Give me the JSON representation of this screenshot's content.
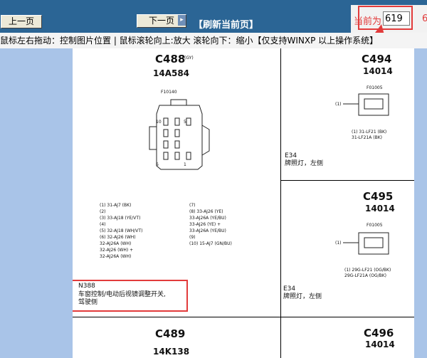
{
  "toolbar": {
    "prev_label": "上一页",
    "next_label": "下一页",
    "refresh_label": "【刷新当前页】",
    "current_label": "当前为",
    "current_page": "619",
    "next_arrow": "▸",
    "extra": "6"
  },
  "hint": {
    "text": "鼠标左右拖动：控制图片位置 | 鼠标滚轮向上:放大   滚轮向下：缩小【仅支持WINXP 以上操作系统】"
  },
  "colors": {
    "toolbar_bg": "#2b6595",
    "sidebar_bg": "#a9c4e8",
    "highlight": "#e23b3b"
  },
  "connectors": {
    "c488": {
      "code": "C488",
      "color_code": "(GY)",
      "part_number": "14A584",
      "figure_ref": "F10140",
      "pin_top_left": "10",
      "pin_top_right": "5",
      "pin_bottom_left": "6",
      "pin_bottom_right": "1",
      "pins_left": [
        "(1)   31-AJ7 (BK)",
        "(2)",
        "(3)   33-AJ18 (YE/VT)",
        "(4)",
        "(5)   32-AJ18 (WH/VT)",
        "(6)   32-AJ26 (WH)",
        "        32-AJ26A (WH)",
        "        32-AJ26 (WH) +",
        "        32-AJ26A (WH)"
      ],
      "pins_right": [
        "(7)",
        "(8)   33-AJ26 (YE)",
        "        33-AJ26A (YE/BU)",
        "        33-AJ26 (YE) +",
        "        33-AJ26A (YE/BU)",
        "(9)",
        "(10)  15-AJ7 (GN/BU)"
      ],
      "location_code": "N388",
      "location_line1": "车窗控制/电动后视镜调整开关,",
      "location_line2": "驾驶侧"
    },
    "c494": {
      "code": "C494",
      "part_number": "14014",
      "figure_ref": "F01005",
      "pin_label": "(1)",
      "wires": [
        "(1)   31-LF21 (BK)",
        "        31-LF21A (BK)"
      ],
      "location_code": "E34",
      "location_desc": "牌照灯，左侧"
    },
    "c495": {
      "code": "C495",
      "part_number": "14014",
      "figure_ref": "F01005",
      "pin_label": "(1)",
      "wires": [
        "(1)   29G-LF21 (OG/BK)",
        "        29G-LF21A (OG/BK)"
      ],
      "location_code": "E34",
      "location_desc": "牌照灯，左侧"
    },
    "c489": {
      "code": "C489",
      "part_number": "14K138"
    },
    "c496": {
      "code": "C496",
      "part_number": "14014"
    }
  }
}
